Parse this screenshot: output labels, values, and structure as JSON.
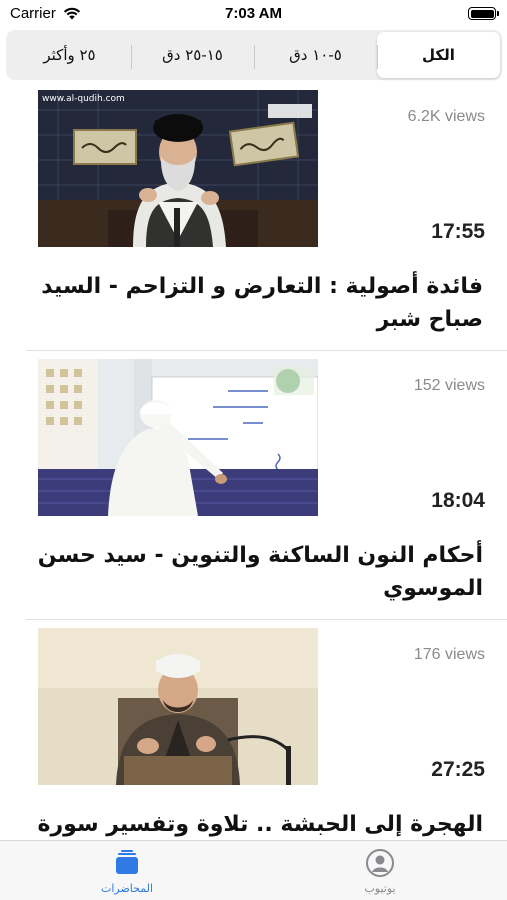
{
  "status_bar": {
    "carrier": "Carrier",
    "time": "7:03 AM"
  },
  "filters": {
    "selected_index": 0,
    "items": [
      "الكل",
      "٥-١٠ دق",
      "١٥-٢٥ دق",
      "٢٥ وأكثر"
    ]
  },
  "videos": [
    {
      "title": "فائدة أصولية : التعارض و التزاحم - السيد صباح شبر",
      "views": "6.2K views",
      "duration": "17:55"
    },
    {
      "title": "أحكام النون الساكنة والتنوين - سيد حسن الموسوي",
      "views": "152 views",
      "duration": "18:04"
    },
    {
      "title": "الهجرة إلى الحبشة .. تلاوة وتفسير سورة الزمر",
      "views": "176 views",
      "duration": "27:25"
    }
  ],
  "thumb_watermark": "www.al-qudih.com",
  "tabbar": {
    "lectures_label": "المحاضرات",
    "youtube_label": "يوتيوب",
    "active_color": "#2f7ae5",
    "inactive_color": "#8a8a8e"
  }
}
